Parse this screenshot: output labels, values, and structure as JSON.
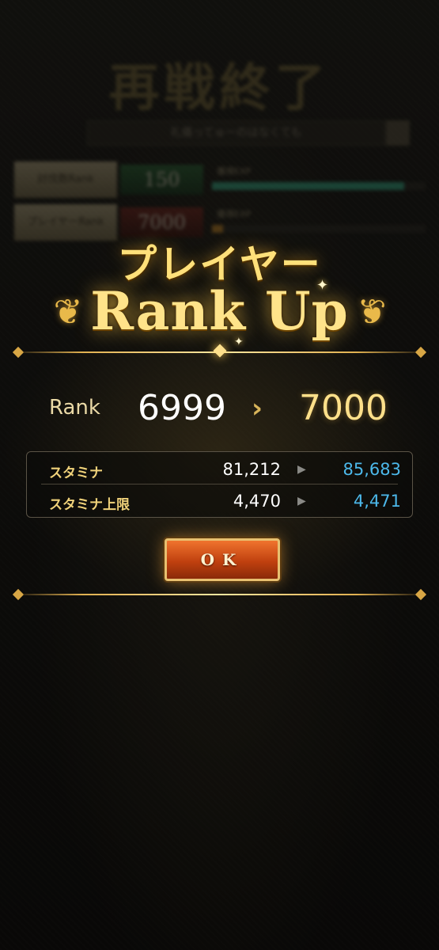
{
  "background": {
    "title": "再戦終了",
    "search_text": "礼儀ってゅーのはなくても",
    "rows": [
      {
        "label": "討伐数Rank",
        "value": "150",
        "exp_label": "獲得EXP",
        "bar_fill": 0.9,
        "bar_color": "#3bb08a"
      },
      {
        "label": "プレイヤーRank",
        "value": "7000",
        "exp_label": "獲得EXP",
        "bar_fill": 0.05,
        "bar_color": "#c98a2a"
      }
    ]
  },
  "popup": {
    "heading_jp": "プレイヤー",
    "heading_en": "Rank Up",
    "rank": {
      "label": "Rank",
      "old": "6999",
      "arrow": "›",
      "new": "7000"
    },
    "stats": [
      {
        "name": "スタミナ",
        "old": "81,212",
        "arrow": "▶",
        "new": "85,683"
      },
      {
        "name": "スタミナ上限",
        "old": "4,470",
        "arrow": "▶",
        "new": "4,471"
      }
    ],
    "ok_label": "OK"
  },
  "colors": {
    "accent_gold": "#ffe08a",
    "new_value_blue": "#4cb8ea",
    "button_orange": "#d85a1e"
  }
}
